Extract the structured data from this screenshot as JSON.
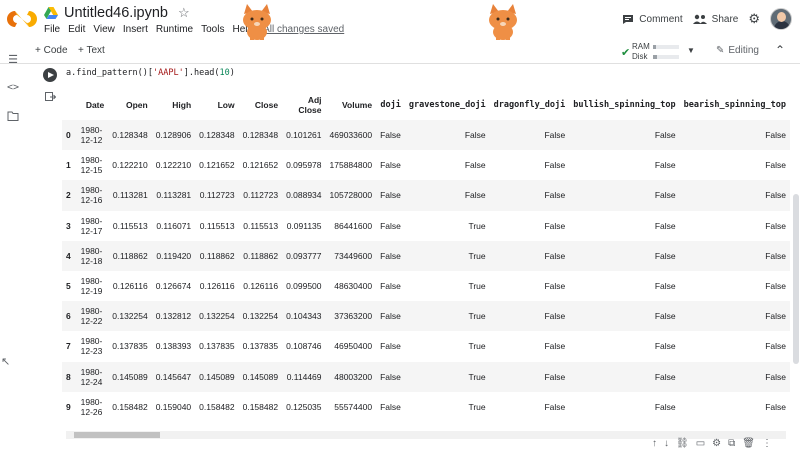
{
  "app": {
    "notebook_title": "Untitled46.ipynb",
    "menu": [
      "File",
      "Edit",
      "View",
      "Insert",
      "Runtime",
      "Tools",
      "Help"
    ],
    "save_status": "All changes saved",
    "comment_label": "Comment",
    "share_label": "Share"
  },
  "toolbar": {
    "code_label": "+ Code",
    "text_label": "+ Text",
    "ram_label": "RAM",
    "disk_label": "Disk",
    "ram_usage": 0.12,
    "disk_usage": 0.14,
    "editing_label": "Editing"
  },
  "cell": {
    "code_prefix": "a.find_pattern()[",
    "code_string": "'AAPL'",
    "code_mid": "].head(",
    "code_number": "10",
    "code_suffix": ")"
  },
  "table": {
    "columns": [
      "",
      "Date",
      "Open",
      "High",
      "Low",
      "Close",
      "Adj Close",
      "Volume",
      "doji",
      "gravestone_doji",
      "dragonfly_doji",
      "bullish_spinning_top",
      "bearish_spinning_top"
    ],
    "rows": [
      [
        "0",
        "1980-12-12",
        "0.128348",
        "0.128906",
        "0.128348",
        "0.128348",
        "0.101261",
        "469033600",
        "False",
        "False",
        "False",
        "False",
        "False"
      ],
      [
        "1",
        "1980-12-15",
        "0.122210",
        "0.122210",
        "0.121652",
        "0.121652",
        "0.095978",
        "175884800",
        "False",
        "False",
        "False",
        "False",
        "False"
      ],
      [
        "2",
        "1980-12-16",
        "0.113281",
        "0.113281",
        "0.112723",
        "0.112723",
        "0.088934",
        "105728000",
        "False",
        "False",
        "False",
        "False",
        "False"
      ],
      [
        "3",
        "1980-12-17",
        "0.115513",
        "0.116071",
        "0.115513",
        "0.115513",
        "0.091135",
        "86441600",
        "False",
        "True",
        "False",
        "False",
        "False"
      ],
      [
        "4",
        "1980-12-18",
        "0.118862",
        "0.119420",
        "0.118862",
        "0.118862",
        "0.093777",
        "73449600",
        "False",
        "True",
        "False",
        "False",
        "False"
      ],
      [
        "5",
        "1980-12-19",
        "0.126116",
        "0.126674",
        "0.126116",
        "0.126116",
        "0.099500",
        "48630400",
        "False",
        "True",
        "False",
        "False",
        "False"
      ],
      [
        "6",
        "1980-12-22",
        "0.132254",
        "0.132812",
        "0.132254",
        "0.132254",
        "0.104343",
        "37363200",
        "False",
        "True",
        "False",
        "False",
        "False"
      ],
      [
        "7",
        "1980-12-23",
        "0.137835",
        "0.138393",
        "0.137835",
        "0.137835",
        "0.108746",
        "46950400",
        "False",
        "True",
        "False",
        "False",
        "False"
      ],
      [
        "8",
        "1980-12-24",
        "0.145089",
        "0.145647",
        "0.145089",
        "0.145089",
        "0.114469",
        "48003200",
        "False",
        "True",
        "False",
        "False",
        "False"
      ],
      [
        "9",
        "1980-12-26",
        "0.158482",
        "0.159040",
        "0.158482",
        "0.158482",
        "0.125035",
        "55574400",
        "False",
        "True",
        "False",
        "False",
        "False"
      ]
    ]
  },
  "colors": {
    "logo_orange": "#f9ab00",
    "logo_dark_orange": "#e8710a",
    "saved_check": "#1e8e3e",
    "row_stripe": "#f5f5f5"
  },
  "icons": [
    "colab-logo",
    "drive-icon",
    "star-icon",
    "comment-icon",
    "share-icon",
    "gear-icon",
    "avatar",
    "check-icon",
    "dropdown-icon",
    "pencil-icon",
    "collapse-icon",
    "toc-icon",
    "code-snippets-icon",
    "files-icon",
    "run-icon",
    "output-icon",
    "cat-sticker"
  ]
}
